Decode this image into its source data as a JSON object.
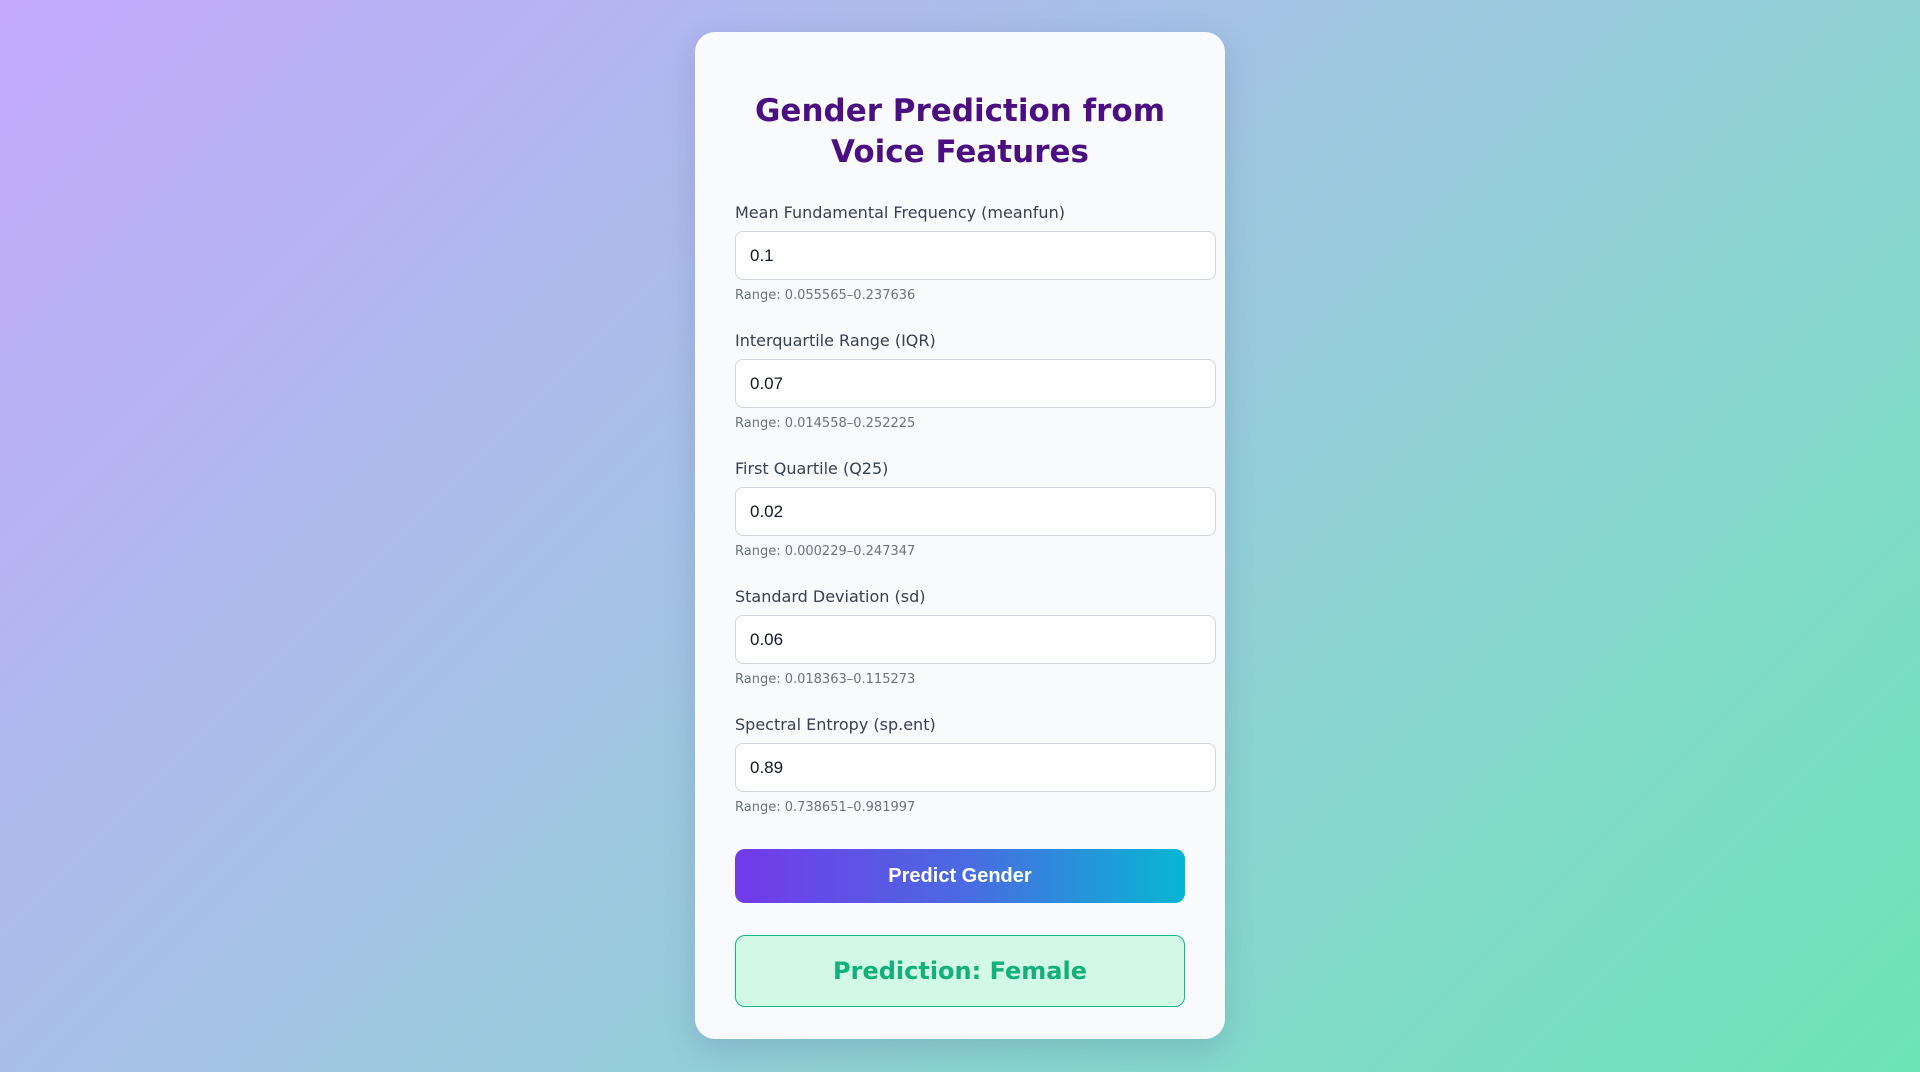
{
  "title": "Gender Prediction from Voice Features",
  "fields": [
    {
      "label": "Mean Fundamental Frequency (meanfun)",
      "value": "0.1",
      "hint": "Range: 0.055565–0.237636"
    },
    {
      "label": "Interquartile Range (IQR)",
      "value": "0.07",
      "hint": "Range: 0.014558–0.252225"
    },
    {
      "label": "First Quartile (Q25)",
      "value": "0.02",
      "hint": "Range: 0.000229–0.247347"
    },
    {
      "label": "Standard Deviation (sd)",
      "value": "0.06",
      "hint": "Range: 0.018363–0.115273"
    },
    {
      "label": "Spectral Entropy (sp.ent)",
      "value": "0.89",
      "hint": "Range: 0.738651–0.981997"
    }
  ],
  "button": {
    "label": "Predict Gender"
  },
  "result": {
    "text": "Prediction: Female"
  },
  "colors": {
    "title": "#4b0f82",
    "accent_start": "#7439ea",
    "accent_end": "#08b6d4",
    "success": "#11b07c",
    "success_bg": "#d2f8e6"
  }
}
